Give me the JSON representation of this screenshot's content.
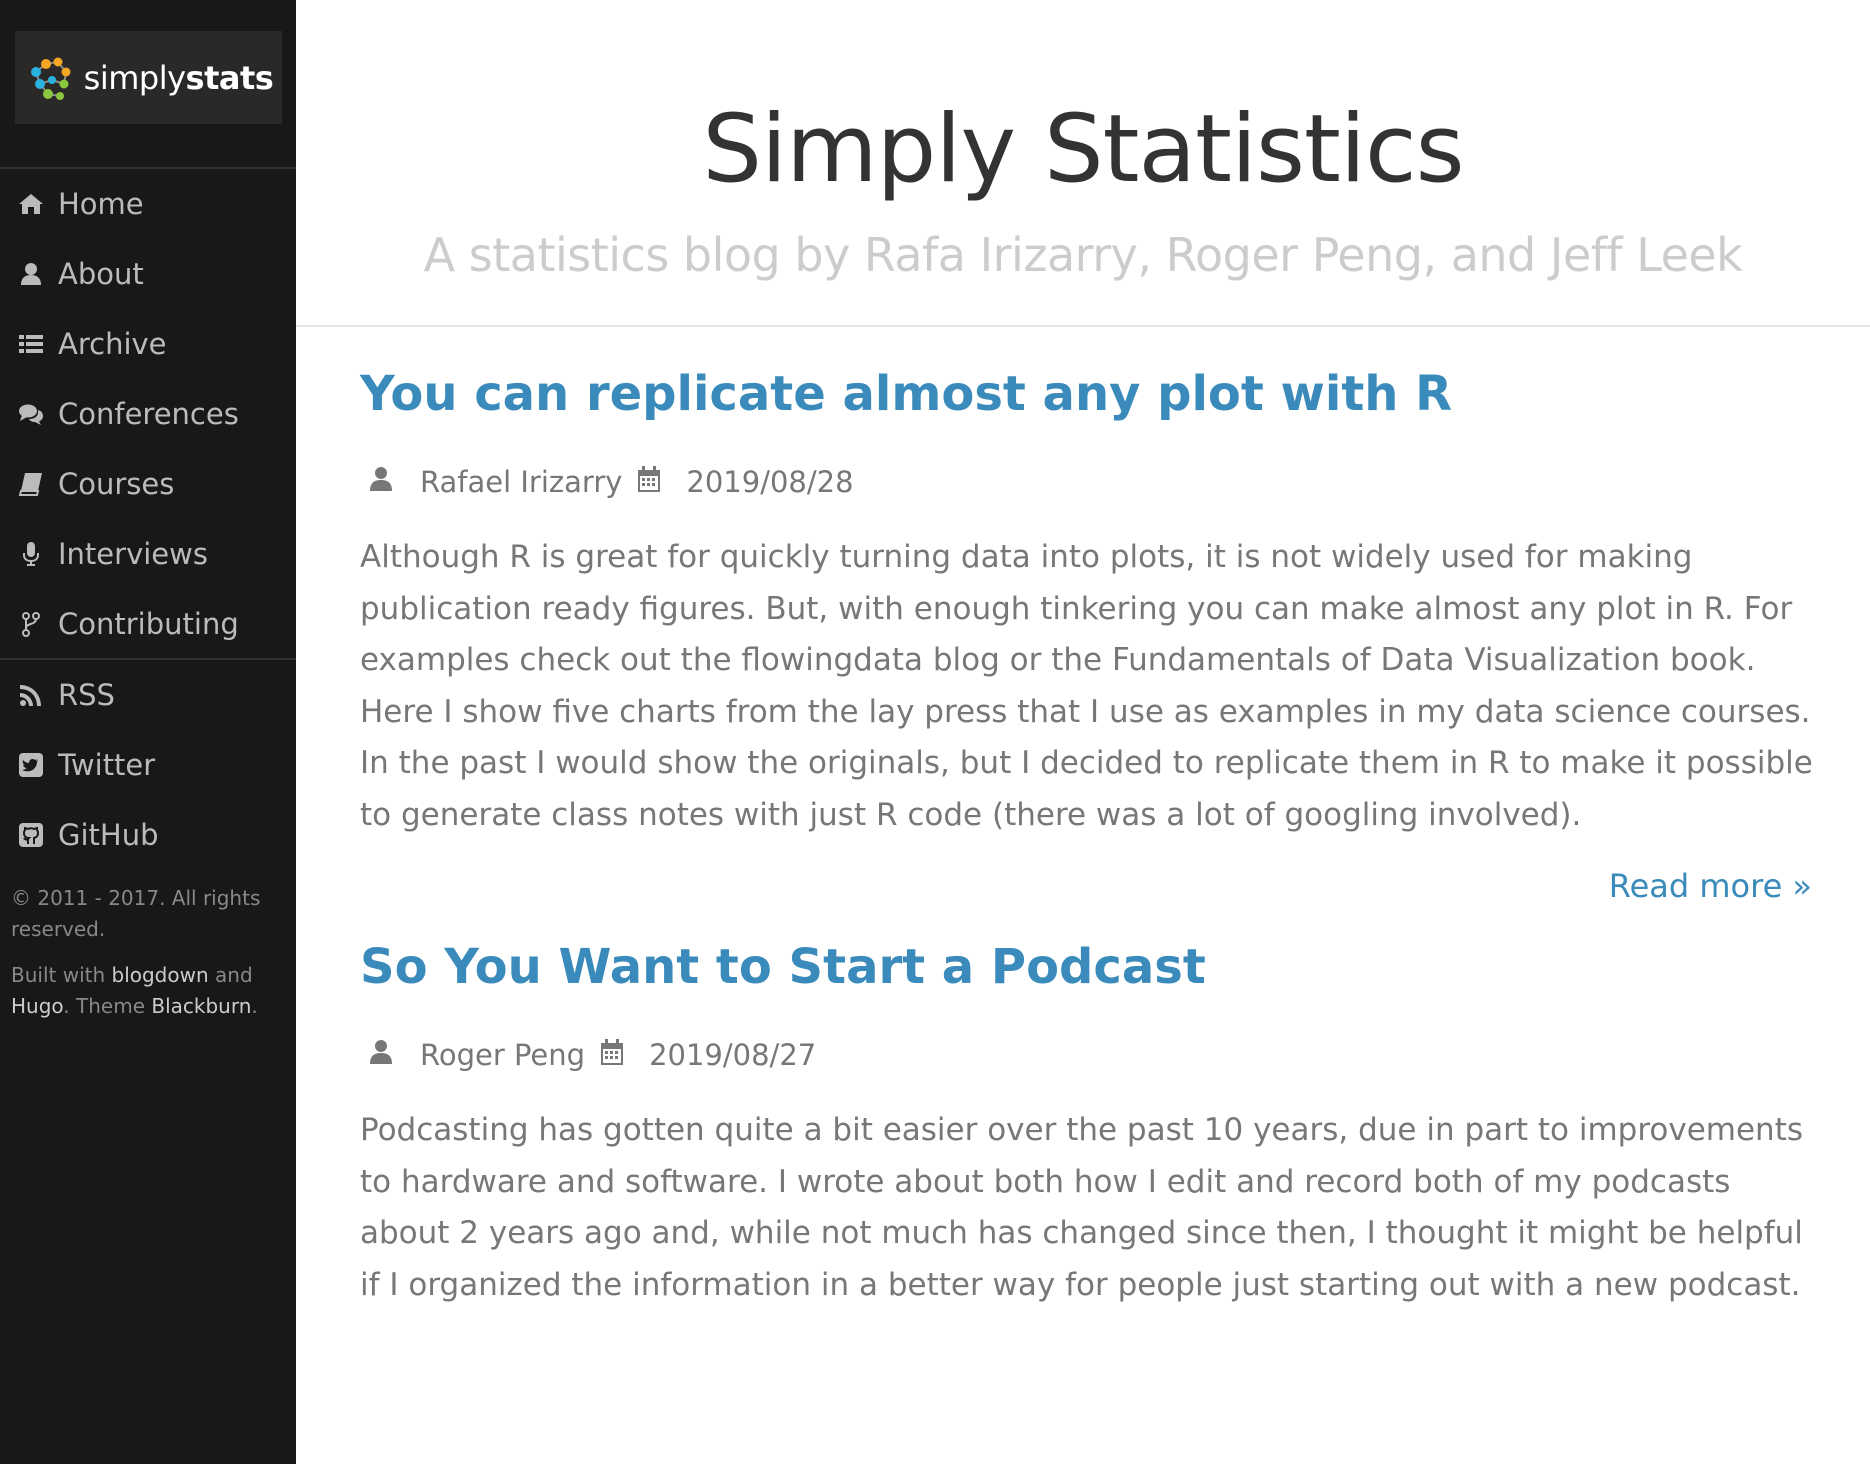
{
  "logo": {
    "light": "simply",
    "bold": "stats"
  },
  "nav": {
    "primary": [
      {
        "label": "Home",
        "icon": "home-icon"
      },
      {
        "label": "About",
        "icon": "user-icon"
      },
      {
        "label": "Archive",
        "icon": "list-icon"
      },
      {
        "label": "Conferences",
        "icon": "comments-icon"
      },
      {
        "label": "Courses",
        "icon": "book-icon"
      },
      {
        "label": "Interviews",
        "icon": "microphone-icon"
      },
      {
        "label": "Contributing",
        "icon": "code-fork-icon"
      }
    ],
    "secondary": [
      {
        "label": "RSS",
        "icon": "rss-icon"
      },
      {
        "label": "Twitter",
        "icon": "twitter-square-icon"
      },
      {
        "label": "GitHub",
        "icon": "github-square-icon"
      }
    ]
  },
  "footer": {
    "copyright": "© 2011 - 2017. All rights reserved.",
    "built_with": "Built with",
    "blogdown": "blogdown",
    "and": "and",
    "hugo": "Hugo",
    "theme": ". Theme",
    "blackburn": "Blackburn",
    "period": "."
  },
  "header": {
    "title": "Simply Statistics",
    "subtitle": "A statistics blog by Rafa Irizarry, Roger Peng, and Jeff Leek"
  },
  "posts": [
    {
      "title": "You can replicate almost any plot with R",
      "author": "Rafael Irizarry",
      "date": "2019/08/28",
      "summary": "Although R is great for quickly turning data into plots, it is not widely used for making publication ready figures. But, with enough tinkering you can make almost any plot in R. For examples check out the flowingdata blog or the Fundamentals of Data Visualization book. Here I show five charts from the lay press that I use as examples in my data science courses. In the past I would show the originals, but I decided to replicate them in R to make it possible to generate class notes with just R code (there was a lot of googling involved).",
      "read_more": "Read more »"
    },
    {
      "title": "So You Want to Start a Podcast",
      "author": "Roger Peng",
      "date": "2019/08/27",
      "summary": "Podcasting has gotten quite a bit easier over the past 10 years, due in part to improvements to hardware and software. I wrote about both how I edit and record both of my podcasts about 2 years ago and, while not much has changed since then, I thought it might be helpful if I organized the information in a better way for people just starting out with a new podcast."
    }
  ],
  "colors": {
    "sidebar_bg": "#191818",
    "accent": "#3a8bbb",
    "body_text": "#777777"
  }
}
